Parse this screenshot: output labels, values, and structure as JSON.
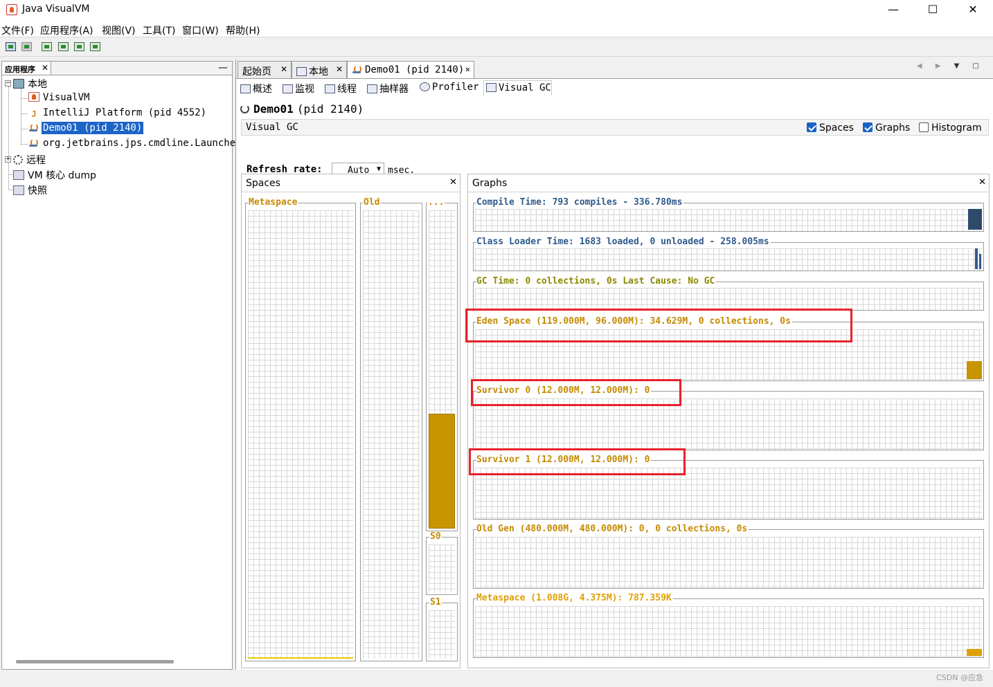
{
  "window": {
    "title": "Java VisualVM",
    "minimize": "—",
    "maximize": "☐",
    "close": "✕"
  },
  "menu": [
    "文件(F)",
    "应用程序(A)",
    "视图(V)",
    "工具(T)",
    "窗口(W)",
    "帮助(H)"
  ],
  "left_panel": {
    "tab_label": "应用程序",
    "tree": [
      {
        "label": "本地",
        "icon": "computer-icon"
      },
      {
        "label": "VisualVM",
        "icon": "visualvm-icon"
      },
      {
        "label": "IntelliJ Platform (pid 4552)",
        "icon": "intellij-icon"
      },
      {
        "label": "Demo01 (pid 2140)",
        "icon": "java-icon",
        "selected": true
      },
      {
        "label": "org.jetbrains.jps.cmdline.Launcher",
        "icon": "java-icon"
      },
      {
        "label": "远程",
        "icon": "remote-icon"
      },
      {
        "label": "VM 核心 dump",
        "icon": "vm-dump-icon"
      },
      {
        "label": "快照",
        "icon": "snapshot-icon"
      }
    ]
  },
  "doc_tabs": [
    {
      "label": "起始页"
    },
    {
      "label": "本地"
    },
    {
      "label": "Demo01 (pid 2140)",
      "active": true
    }
  ],
  "sub_tabs": [
    "概述",
    "监视",
    "线程",
    "抽样器",
    "Profiler",
    "Visual GC"
  ],
  "page": {
    "app_name": "Demo01",
    "pid": "(pid 2140)",
    "section": "Visual GC",
    "checkboxes": [
      {
        "label": "Spaces",
        "checked": true
      },
      {
        "label": "Graphs",
        "checked": true
      },
      {
        "label": "Histogram",
        "checked": false
      }
    ],
    "refresh_label": "Refresh rate:",
    "refresh_value": "Auto",
    "refresh_unit": "msec."
  },
  "spaces": {
    "title": "Spaces",
    "metaspace": "Metaspace",
    "old": "Old",
    "eden": "...",
    "s0": "S0",
    "s1": "S1",
    "eden_fill_fraction": 0.36
  },
  "graphs": {
    "title": "Graphs",
    "compile_time": "Compile Time: 793 compiles - 336.780ms",
    "class_loader_time": "Class Loader Time: 1683 loaded, 0 unloaded - 258.005ms",
    "gc_time": "GC Time: 0 collections, 0s Last Cause: No GC",
    "eden_space": "Eden Space (119.000M, 96.000M): 34.629M, 0 collections, 0s",
    "survivor_0": "Survivor 0 (12.000M, 12.000M): 0",
    "survivor_1": "Survivor 1 (12.000M, 12.000M): 0",
    "old_gen": "Old Gen (480.000M, 480.000M): 0, 0 collections, 0s",
    "metaspace": "Metaspace (1.008G, 4.375M): 787.359K"
  },
  "colors": {
    "compile": "#2e5a8a",
    "class_loader": "#2e5a8a",
    "gc": "#8a8a00",
    "space": "#c58a00",
    "highlight": "#e8212a",
    "selection": "#1e64c8"
  },
  "watermark": "CSDN @应急"
}
